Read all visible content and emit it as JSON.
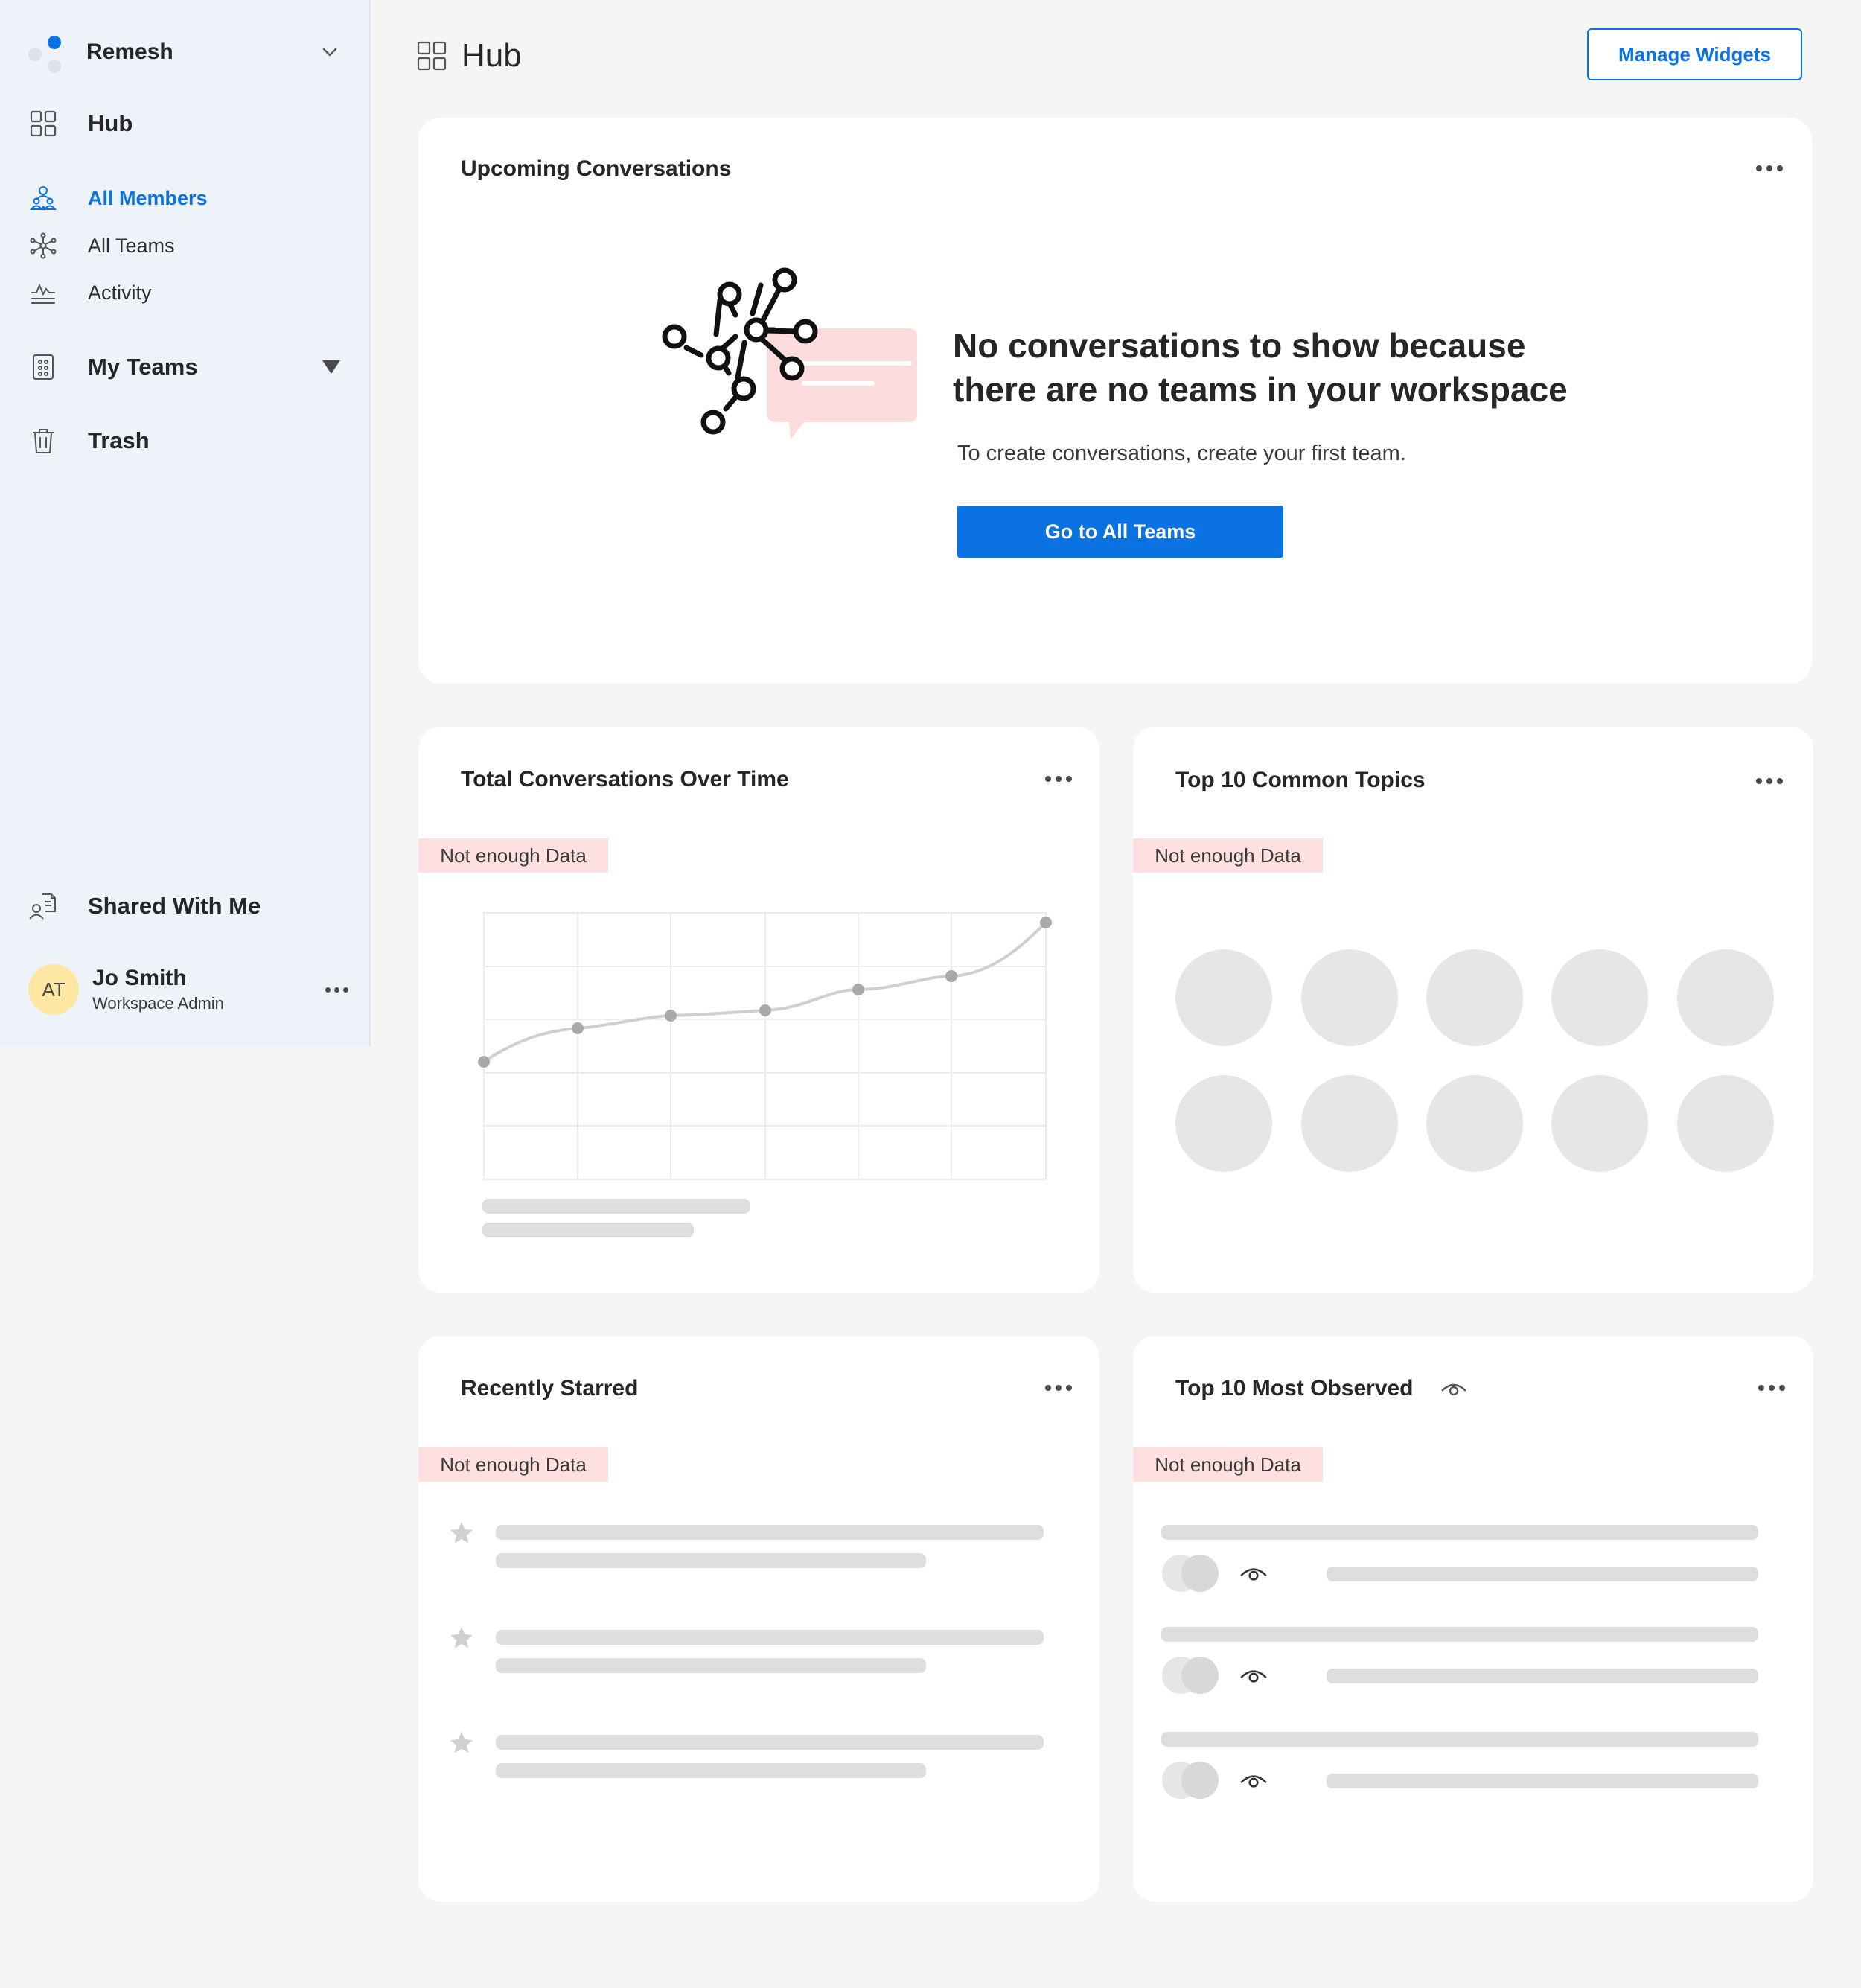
{
  "workspace": {
    "name": "Remesh"
  },
  "sidebar": {
    "hub": "Hub",
    "all_members": "All Members",
    "all_teams": "All Teams",
    "activity": "Activity",
    "my_teams": "My Teams",
    "trash": "Trash",
    "shared_with_me": "Shared With Me"
  },
  "user": {
    "initials": "AT",
    "name": "Jo Smith",
    "role": "Workspace Admin"
  },
  "header": {
    "title": "Hub",
    "manage_widgets": "Manage Widgets"
  },
  "upcoming": {
    "title": "Upcoming Conversations",
    "empty_line1": "No conversations to show because",
    "empty_line2": "there are no teams in your workspace",
    "empty_sub": "To create conversations, create your first team.",
    "cta": "Go to All Teams"
  },
  "total_conversations": {
    "title": "Total Conversations Over Time",
    "badge": "Not enough Data"
  },
  "common_topics": {
    "title": "Top 10 Common Topics",
    "badge": "Not enough Data"
  },
  "recently_starred": {
    "title": "Recently Starred",
    "badge": "Not enough Data"
  },
  "most_observed": {
    "title": "Top 10 Most Observed",
    "badge": "Not enough Data"
  },
  "colors": {
    "accent": "#0b72e3",
    "badge_bg": "#fde0df",
    "sidebar_bg": "#eef3fa",
    "avatar_bg": "#fde7a3"
  }
}
